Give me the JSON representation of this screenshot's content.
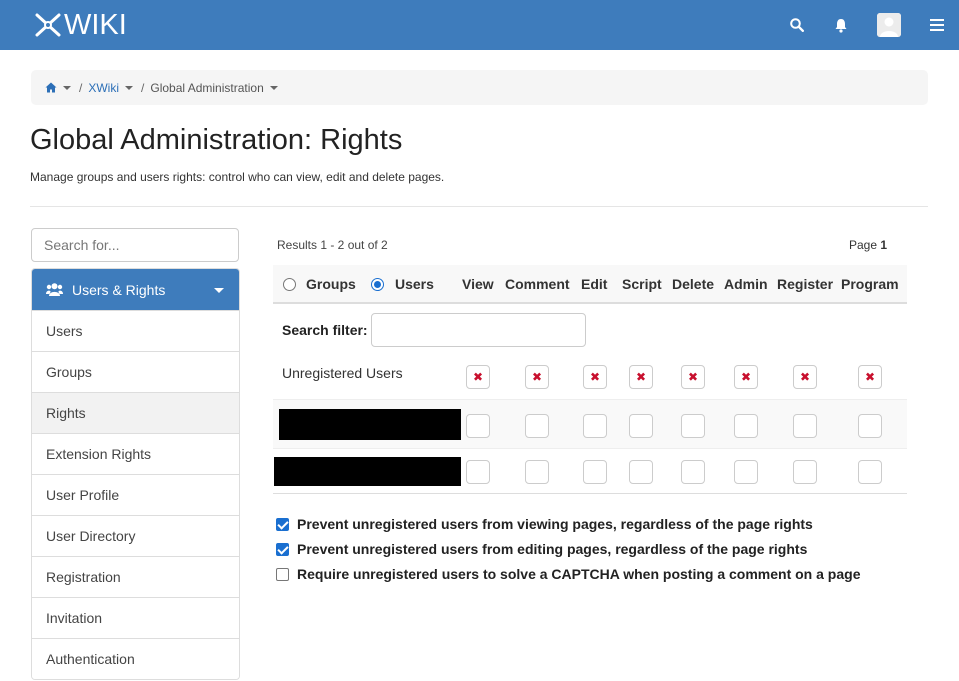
{
  "app": {
    "logo_text": "WIKI"
  },
  "topbar": {
    "icons": [
      "search-icon",
      "bell-icon",
      "user-avatar",
      "menu-icon"
    ]
  },
  "breadcrumb": {
    "items": [
      {
        "label": "",
        "icon": "home-icon"
      },
      {
        "label": "XWiki"
      },
      {
        "label": "Global Administration"
      }
    ]
  },
  "page": {
    "title": "Global Administration: Rights",
    "description": "Manage groups and users rights: control who can view, edit and delete pages."
  },
  "sidebar": {
    "search_placeholder": "Search for...",
    "header": "Users & Rights",
    "items": [
      {
        "label": "Users"
      },
      {
        "label": "Groups"
      },
      {
        "label": "Rights",
        "active": true
      },
      {
        "label": "Extension Rights"
      },
      {
        "label": "User Profile"
      },
      {
        "label": "User Directory"
      },
      {
        "label": "Registration"
      },
      {
        "label": "Invitation"
      },
      {
        "label": "Authentication"
      }
    ]
  },
  "rights": {
    "results_text": "Results 1 - 2 out of 2",
    "page_label": "Page",
    "page_number": "1",
    "scope_options": [
      {
        "label": "Groups",
        "selected": false
      },
      {
        "label": "Users",
        "selected": true
      }
    ],
    "columns": [
      "View",
      "Comment",
      "Edit",
      "Script",
      "Delete",
      "Admin",
      "Register",
      "Program"
    ],
    "filter_label": "Search filter:",
    "filter_value": "",
    "rows": [
      {
        "label": "Unregistered Users",
        "states": [
          "deny",
          "deny",
          "deny",
          "deny",
          "deny",
          "deny",
          "deny",
          "deny"
        ]
      },
      {
        "label": "",
        "redacted": true,
        "states": [
          "none",
          "none",
          "none",
          "none",
          "none",
          "none",
          "none",
          "none"
        ]
      },
      {
        "label": "",
        "redacted": true,
        "states": [
          "none",
          "none",
          "none",
          "none",
          "none",
          "none",
          "none",
          "none"
        ]
      }
    ],
    "deny_glyph": "✖"
  },
  "options": [
    {
      "label": "Prevent unregistered users from viewing pages, regardless of the page rights",
      "checked": true
    },
    {
      "label": "Prevent unregistered users from editing pages, regardless of the page rights",
      "checked": true
    },
    {
      "label": "Require unregistered users to solve a CAPTCHA when posting a comment on a page",
      "checked": false
    }
  ],
  "colors": {
    "brand": "#3e7cbc",
    "deny": "#c8102e",
    "check": "#1a6fd0"
  }
}
